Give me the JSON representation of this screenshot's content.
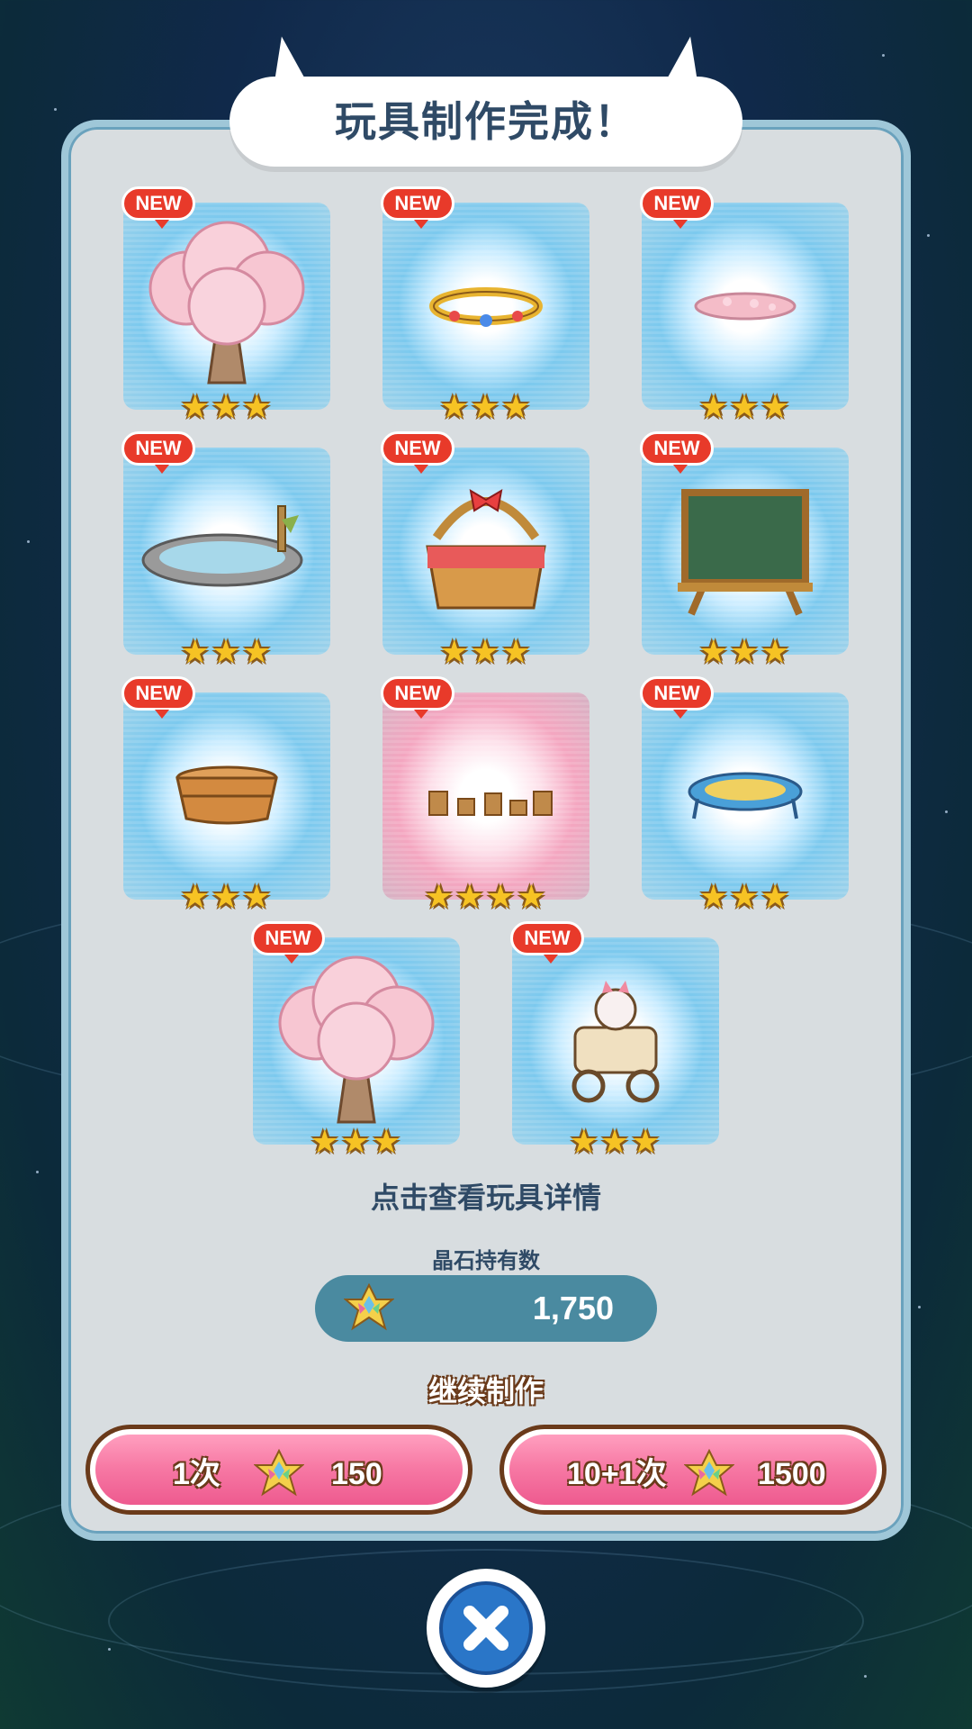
{
  "title": "玩具制作完成！",
  "items": [
    {
      "name": "cherry-tree",
      "badge": "NEW",
      "stars": "★★★",
      "glow": "blue"
    },
    {
      "name": "jeweled-ring",
      "badge": "NEW",
      "stars": "★★★",
      "glow": "blue"
    },
    {
      "name": "petal-pile",
      "badge": "NEW",
      "stars": "★★★",
      "glow": "blue"
    },
    {
      "name": "pond",
      "badge": "NEW",
      "stars": "★★★",
      "glow": "blue"
    },
    {
      "name": "picnic-basket",
      "badge": "NEW",
      "stars": "★★★",
      "glow": "blue"
    },
    {
      "name": "chalkboard",
      "badge": "NEW",
      "stars": "★★★",
      "glow": "blue"
    },
    {
      "name": "wooden-tub",
      "badge": "NEW",
      "stars": "★★★",
      "glow": "blue"
    },
    {
      "name": "tree-stumps",
      "badge": "NEW",
      "stars": "★★★★",
      "glow": "pink"
    },
    {
      "name": "trampoline",
      "badge": "NEW",
      "stars": "★★★",
      "glow": "blue"
    },
    {
      "name": "cherry-tree",
      "badge": "NEW",
      "stars": "★★★",
      "glow": "blue"
    },
    {
      "name": "cat-cart",
      "badge": "NEW",
      "stars": "★★★",
      "glow": "blue"
    }
  ],
  "hint": "点击查看玩具详情",
  "gems": {
    "label": "晶石持有数",
    "count": "1,750"
  },
  "continue_label": "继续制作",
  "buttons": [
    {
      "label": "1次",
      "cost": "150"
    },
    {
      "label": "10+1次",
      "cost": "1500"
    }
  ],
  "colors": {
    "accent_pink": "#f77aa5",
    "panel": "#d8dde0",
    "new_badge": "#e83a2a",
    "gem_pill": "#4a8aa0"
  }
}
